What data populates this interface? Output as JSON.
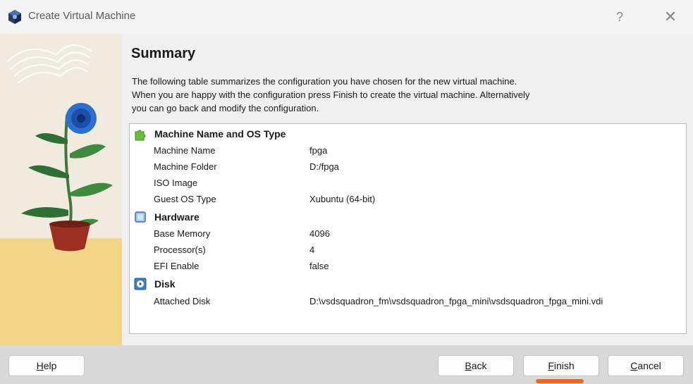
{
  "window": {
    "title": "Create Virtual Machine",
    "help_glyph": "?",
    "close_glyph": "✕"
  },
  "page": {
    "title": "Summary",
    "description": [
      "The following table summarizes the configuration you have chosen for the new virtual machine.",
      "When you are happy with the configuration press Finish to create the virtual machine. Alternatively",
      "you can go back and modify the configuration."
    ]
  },
  "sections": [
    {
      "label": "Machine Name and OS Type",
      "icon": "green-puzzle-icon",
      "rows": [
        {
          "key": "Machine Name",
          "value": "fpga"
        },
        {
          "key": "Machine Folder",
          "value": "D:/fpga"
        },
        {
          "key": "ISO Image",
          "value": ""
        },
        {
          "key": "Guest OS Type",
          "value": "Xubuntu (64-bit)"
        }
      ]
    },
    {
      "label": "Hardware",
      "icon": "chip-icon",
      "rows": [
        {
          "key": "Base Memory",
          "value": "4096"
        },
        {
          "key": "Processor(s)",
          "value": "4"
        },
        {
          "key": "EFI Enable",
          "value": "false"
        }
      ]
    },
    {
      "label": "Disk",
      "icon": "disk-icon",
      "rows": [
        {
          "key": "Attached Disk",
          "value": "D:\\vsdsquadron_fm\\vsdsquadron_fpga_mini\\vsdsquadron_fpga_mini.vdi"
        }
      ]
    }
  ],
  "buttons": {
    "help": {
      "mnemonic": "H",
      "rest": "elp"
    },
    "back": {
      "mnemonic": "B",
      "rest": "ack"
    },
    "finish": {
      "mnemonic": "F",
      "rest": "inish"
    },
    "cancel": {
      "mnemonic": "C",
      "rest": "ancel"
    }
  },
  "colors": {
    "annotation_underline": "#ea6a1f",
    "footer_bg": "#d9d9d9",
    "content_bg": "#f0f0f0"
  }
}
